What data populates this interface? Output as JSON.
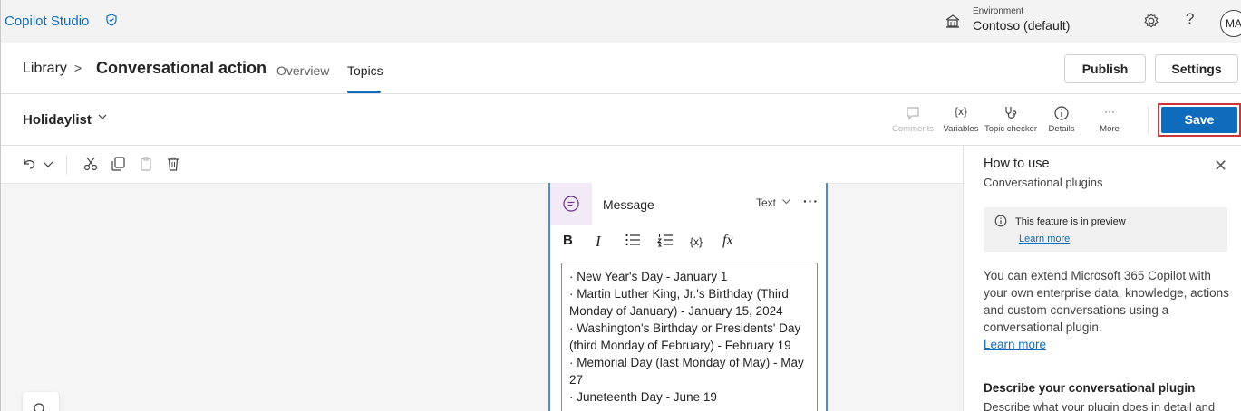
{
  "app": {
    "name": "Copilot Studio",
    "environment_label": "Environment",
    "environment_value": "Contoso (default)",
    "help_glyph": "?",
    "avatar_initials": "MA"
  },
  "breadcrumb": {
    "library": "Library",
    "separator": ">",
    "current": "Conversational action"
  },
  "tabs": [
    {
      "label": "Overview",
      "active": false
    },
    {
      "label": "Topics",
      "active": true
    }
  ],
  "actions": {
    "publish": "Publish",
    "settings": "Settings"
  },
  "topic": {
    "name": "Holidaylist",
    "tools": [
      {
        "label": "Comments",
        "icon": "comment-icon",
        "enabled": false
      },
      {
        "label": "Variables",
        "icon": "variables-icon",
        "glyph": "{x}",
        "enabled": true
      },
      {
        "label": "Topic checker",
        "icon": "stethoscope-icon",
        "enabled": true
      },
      {
        "label": "Details",
        "icon": "info-icon",
        "enabled": true
      },
      {
        "label": "More",
        "icon": "more-icon",
        "glyph": "···",
        "enabled": true
      }
    ],
    "save": "Save"
  },
  "canvas_toolbar": {
    "icons": [
      "undo-icon",
      "undo-dropdown-icon",
      "cut-icon",
      "copy-icon",
      "paste-icon",
      "delete-icon"
    ]
  },
  "node": {
    "title": "Message",
    "type": "Text",
    "more_glyph": "···",
    "format_tools": {
      "bold": "B",
      "italic": "I",
      "variable": "{x}",
      "formula": "fx"
    },
    "lines": [
      "· New Year's Day - January 1",
      "· Martin Luther King, Jr.'s Birthday (Third Monday of January) - January 15, 2024",
      "· Washington's Birthday or Presidents' Day (third Monday of February) - February 19",
      "· Memorial Day (last Monday of May) - May 27",
      "· Juneteenth Day - June 19"
    ]
  },
  "panel": {
    "title": "How to use",
    "subtitle": "Conversational plugins",
    "close_glyph": "✕",
    "preview_text": "This feature is in preview",
    "preview_link": "Learn more",
    "body": "You can extend Microsoft 365 Copilot with your own enterprise data, knowledge, actions and custom conversations using a conversational plugin.",
    "body_link": "Learn more",
    "section_title": "Describe your conversational plugin",
    "section_text_partial": "Describe what your plugin does in detail and"
  },
  "colors": {
    "accent": "#0f6cbd",
    "highlight_border": "#d13438",
    "node_border": "#4f8ad6",
    "node_icon_bg": "#f2eaf7"
  }
}
